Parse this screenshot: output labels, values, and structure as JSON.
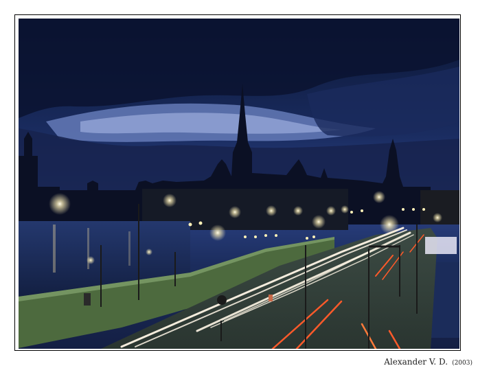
{
  "photo": {
    "subject": "night city view with light trails",
    "colors": {
      "sky_top": "#0d1a3d",
      "sky_mid": "#23376e",
      "horizon": "#8fa2d6",
      "water": "#1c2d5a",
      "road": "#3a4a3a",
      "streetlight": "#fff6d8",
      "light_trail": "#fff4e0",
      "tail_light": "#ff5a2a"
    }
  },
  "credit": {
    "author": "Alexander V. D.",
    "year": "(2003)"
  }
}
